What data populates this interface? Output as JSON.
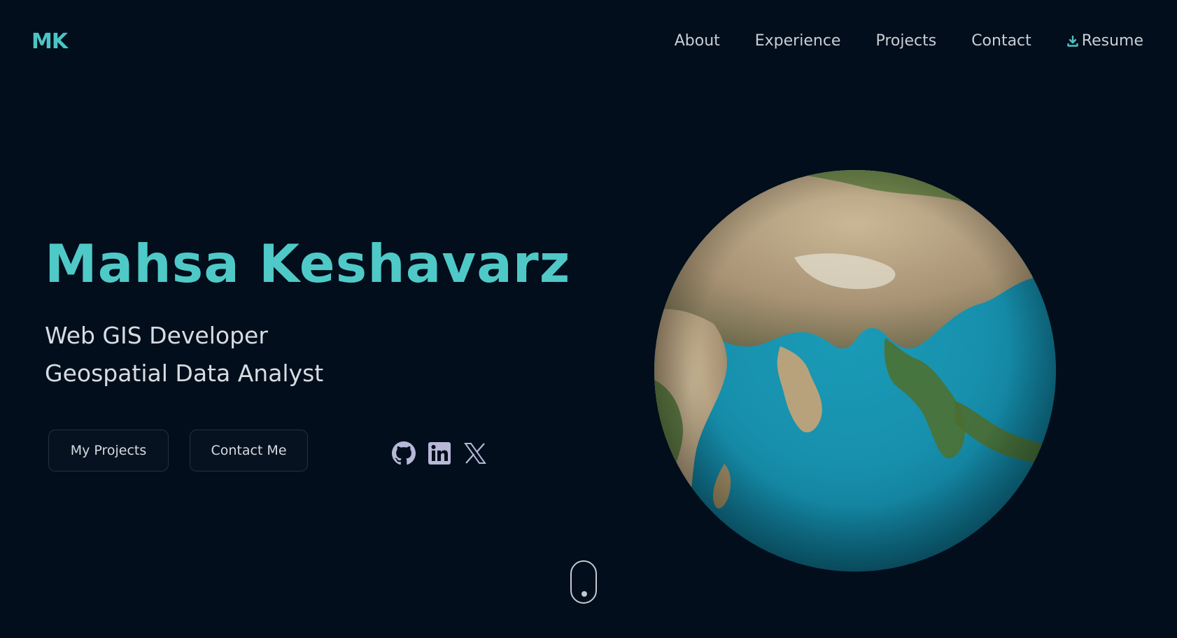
{
  "logo": {
    "text": "MK"
  },
  "nav": {
    "items": [
      {
        "label": "About"
      },
      {
        "label": "Experience"
      },
      {
        "label": "Projects"
      },
      {
        "label": "Contact"
      }
    ],
    "resume": {
      "label": "Resume",
      "icon": "download-icon"
    }
  },
  "hero": {
    "name": "Mahsa Keshavarz",
    "subtitles": [
      "Web GIS Developer",
      "Geospatial Data Analyst"
    ],
    "buttons": {
      "projects": "My Projects",
      "contact": "Contact Me"
    }
  },
  "socials": [
    {
      "icon": "github-icon"
    },
    {
      "icon": "linkedin-icon"
    },
    {
      "icon": "x-twitter-icon"
    }
  ],
  "globe": {
    "icon": "earth-globe"
  },
  "scroll": {
    "icon": "mouse-scroll-icon"
  },
  "colors": {
    "background": "#020e1b",
    "accent": "#4fc9c7",
    "text": "#d6dbe2",
    "icon": "#b6b8d6"
  }
}
